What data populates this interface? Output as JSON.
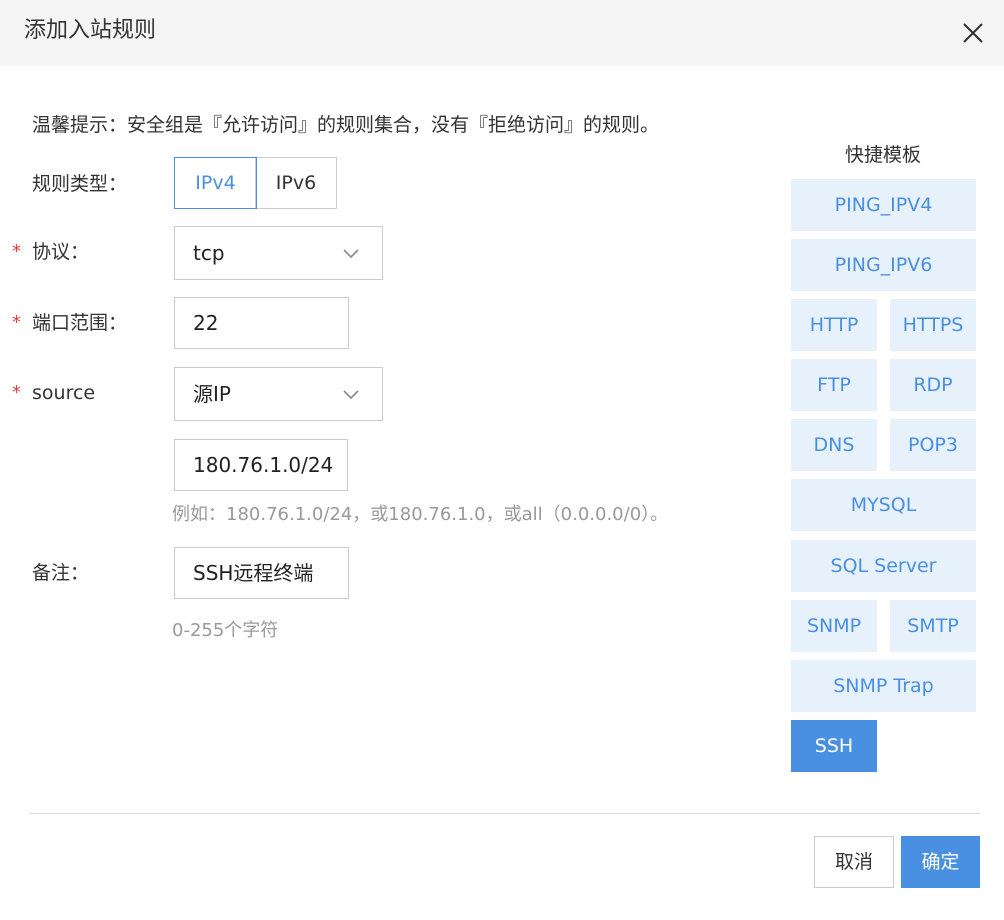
{
  "dialog": {
    "title": "添加入站规则",
    "tip": "温馨提示：安全组是『允许访问』的规则集合，没有『拒绝访问』的规则。"
  },
  "form": {
    "rule_type": {
      "label": "规则类型：",
      "options": [
        "IPv4",
        "IPv6"
      ],
      "selected": "IPv4"
    },
    "protocol": {
      "label": "协议：",
      "required": "*",
      "value": "tcp"
    },
    "port": {
      "label": "端口范围：",
      "required": "*",
      "value": "22"
    },
    "source": {
      "label": "source",
      "required": "*",
      "type_value": "源IP",
      "cidr_value": "180.76.1.0/24",
      "hint": "例如：180.76.1.0/24，或180.76.1.0，或all（0.0.0.0/0）。"
    },
    "note": {
      "label": "备注：",
      "value": "SSH远程终端",
      "hint": "0-255个字符"
    }
  },
  "templates": {
    "title": "快捷模板",
    "items": [
      "PING_IPV4",
      "PING_IPV6",
      "HTTP",
      "HTTPS",
      "FTP",
      "RDP",
      "DNS",
      "POP3",
      "MYSQL",
      "SQL Server",
      "SNMP",
      "SMTP",
      "SNMP Trap",
      "SSH"
    ],
    "selected": "SSH"
  },
  "footer": {
    "cancel_label": "取消",
    "ok_label": "确定"
  },
  "colors": {
    "accent": "#4a90e2",
    "template_bg": "#e7f1fb",
    "required": "#e04040",
    "header_bg": "#f5f5f5"
  },
  "icons": {
    "close": "close-icon",
    "dropdown": "chevron-down-icon"
  }
}
